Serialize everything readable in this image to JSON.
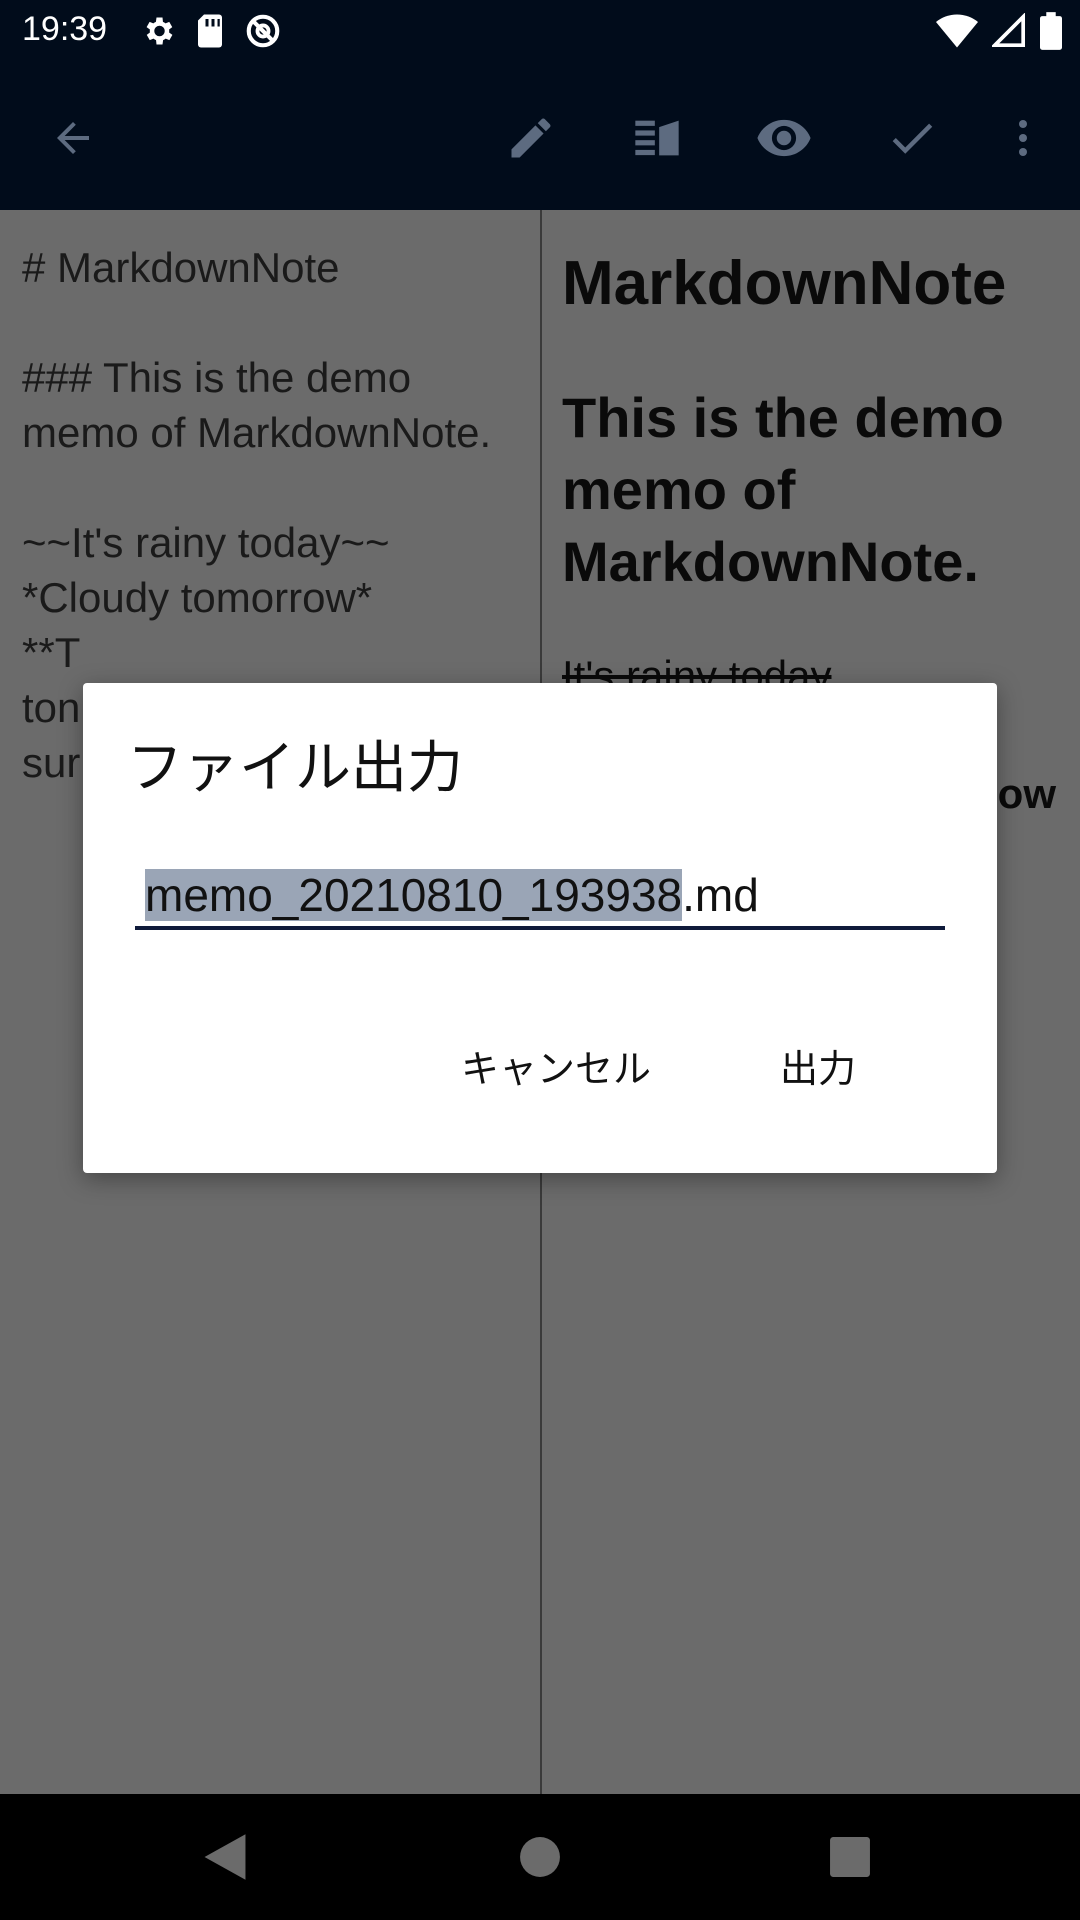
{
  "status_bar": {
    "time": "19:39",
    "left_icons": [
      "settings-icon",
      "sd-card-icon",
      "sync-off-icon"
    ],
    "right_icons": [
      "wifi-icon",
      "cell-signal-icon",
      "battery-icon"
    ]
  },
  "app_bar": {
    "icons": [
      "back-arrow-icon",
      "edit-pencil-icon",
      "split-view-icon",
      "preview-eye-icon",
      "check-icon",
      "more-vert-icon"
    ],
    "color": "#010c1b"
  },
  "editor": {
    "text": "# MarkdownNote\n\n### This is the demo memo of MarkdownNote.\n\n~~It's rainy today~~\n*Cloudy tomorrow*\n**T\nton\nsur"
  },
  "preview": {
    "h1": "MarkdownNote",
    "h3": "This is the demo memo of MarkdownNote.",
    "strike": "It's rainy today",
    "bold_partial": "ow"
  },
  "dialog": {
    "title": "ファイル出力",
    "filename_selected": "memo_20210810_193938",
    "filename_suffix": ".md",
    "cancel_label": "キャンセル",
    "export_label": "出力",
    "accent_color": "#0f1a3a"
  },
  "nav_bar": {
    "icons": [
      "nav-back-icon",
      "nav-home-icon",
      "nav-recents-icon"
    ]
  }
}
